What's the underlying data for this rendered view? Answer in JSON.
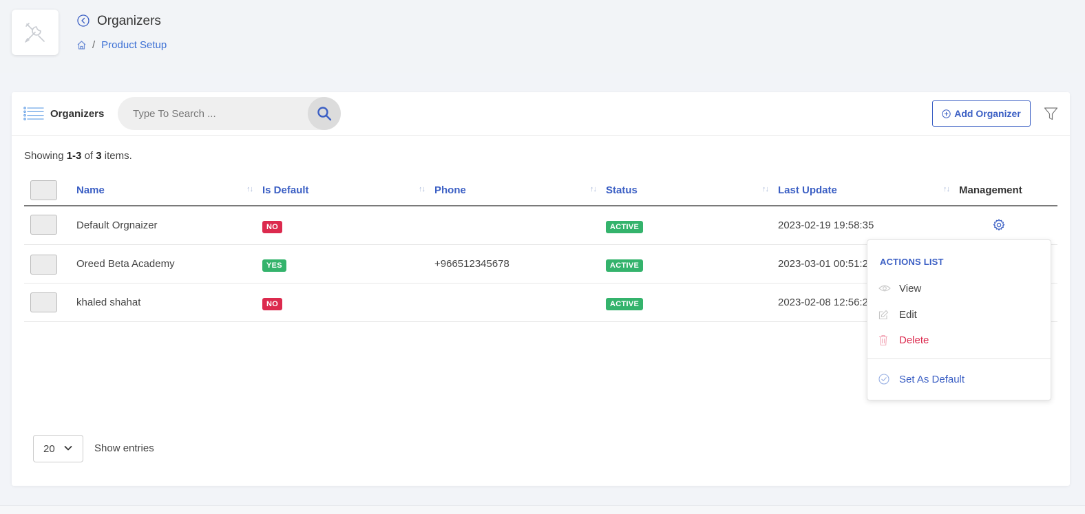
{
  "header": {
    "title": "Organizers",
    "breadcrumb": {
      "current": "Product Setup"
    }
  },
  "toolbar": {
    "title": "Organizers",
    "search_placeholder": "Type To Search ...",
    "add_label": "Add Organizer"
  },
  "summary": {
    "prefix": "Showing ",
    "range": "1-3",
    "mid": " of ",
    "total": "3",
    "suffix": " items."
  },
  "table": {
    "columns": [
      "Name",
      "Is Default",
      "Phone",
      "Status",
      "Last Update",
      "Management"
    ],
    "rows": [
      {
        "name": "Default Orgnaizer",
        "is_default": "NO",
        "phone": "",
        "status": "ACTIVE",
        "last_update": "2023-02-19 19:58:35"
      },
      {
        "name": "Oreed Beta Academy",
        "is_default": "YES",
        "phone": "+966512345678",
        "status": "ACTIVE",
        "last_update": "2023-03-01 00:51:2"
      },
      {
        "name": "khaled shahat",
        "is_default": "NO",
        "phone": "",
        "status": "ACTIVE",
        "last_update": "2023-02-08 12:56:2"
      }
    ]
  },
  "actions_menu": {
    "title": "ACTIONS LIST",
    "items": [
      "View",
      "Edit",
      "Delete",
      "Set As Default"
    ]
  },
  "pagination": {
    "per_page": "20",
    "label": "Show entries"
  },
  "colors": {
    "accent": "#3b5fc4",
    "danger": "#dc2a4e",
    "success": "#34b36c"
  },
  "icons": [
    "tools-icon",
    "back-icon",
    "home-icon",
    "list-icon",
    "search-icon",
    "add-circle-icon",
    "filter-icon",
    "sort-icon",
    "gear-icon",
    "eye-icon",
    "edit-icon",
    "trash-icon",
    "check-circle-icon",
    "chevron-down-icon"
  ]
}
